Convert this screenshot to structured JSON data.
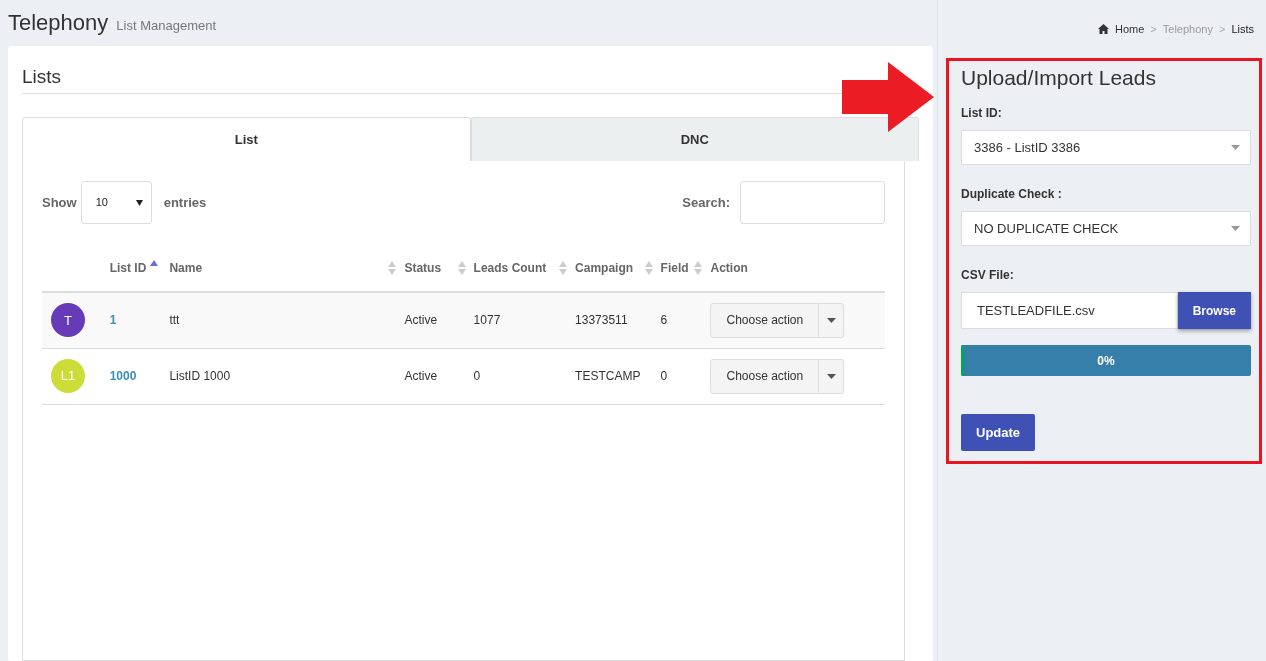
{
  "header": {
    "title": "Telephony",
    "subtitle": "List Management"
  },
  "breadcrumb": [
    {
      "label": "Home",
      "current": false
    },
    {
      "separator": ">",
      "label": "Telephony",
      "current": false
    },
    {
      "separator": ">",
      "label": "Lists",
      "current": true
    }
  ],
  "panel": {
    "title": "Lists"
  },
  "tabs": [
    {
      "label": "List",
      "selected": true
    },
    {
      "label": "DNC",
      "selected": false
    }
  ],
  "length_control": {
    "before": "Show",
    "value": "10",
    "after": "entries"
  },
  "search": {
    "label": "Search:"
  },
  "table": {
    "columns": [
      {},
      {
        "label": "List ID",
        "sorted": true
      },
      {
        "label": "Name",
        "sorted": false
      },
      {
        "label": "Status",
        "sorted": false
      },
      {
        "label": "Leads Count",
        "sorted": false
      },
      {
        "label": "Campaign",
        "sorted": false
      },
      {
        "label": "Field",
        "sorted": false
      },
      {
        "label": "Action"
      }
    ],
    "rows": [
      {
        "avatar": "T",
        "color": "#673ab7",
        "list_id": "1",
        "name": "ttt",
        "status": "Active",
        "leads_count": "1077",
        "campaign": "13373511",
        "field": "6",
        "action": "Choose action"
      },
      {
        "avatar": "L1",
        "color": "#cddc39",
        "list_id": "1000",
        "name": "ListID 1000",
        "status": "Active",
        "leads_count": "0",
        "campaign": "TESTCAMP",
        "field": "0",
        "action": "Choose action"
      }
    ]
  },
  "upload": {
    "title": "Upload/Import Leads",
    "list_id": {
      "label": "List ID:",
      "value": "3386 - ListID 3386"
    },
    "duplicate_check": {
      "label": "Duplicate Check :",
      "value": "NO DUPLICATE CHECK"
    },
    "csv_file": {
      "label": "CSV File:",
      "value": "TESTLEADFILE.csv",
      "button": "Browse"
    },
    "progress": {
      "level": 0,
      "reading": "0%"
    },
    "submit": "Update"
  }
}
